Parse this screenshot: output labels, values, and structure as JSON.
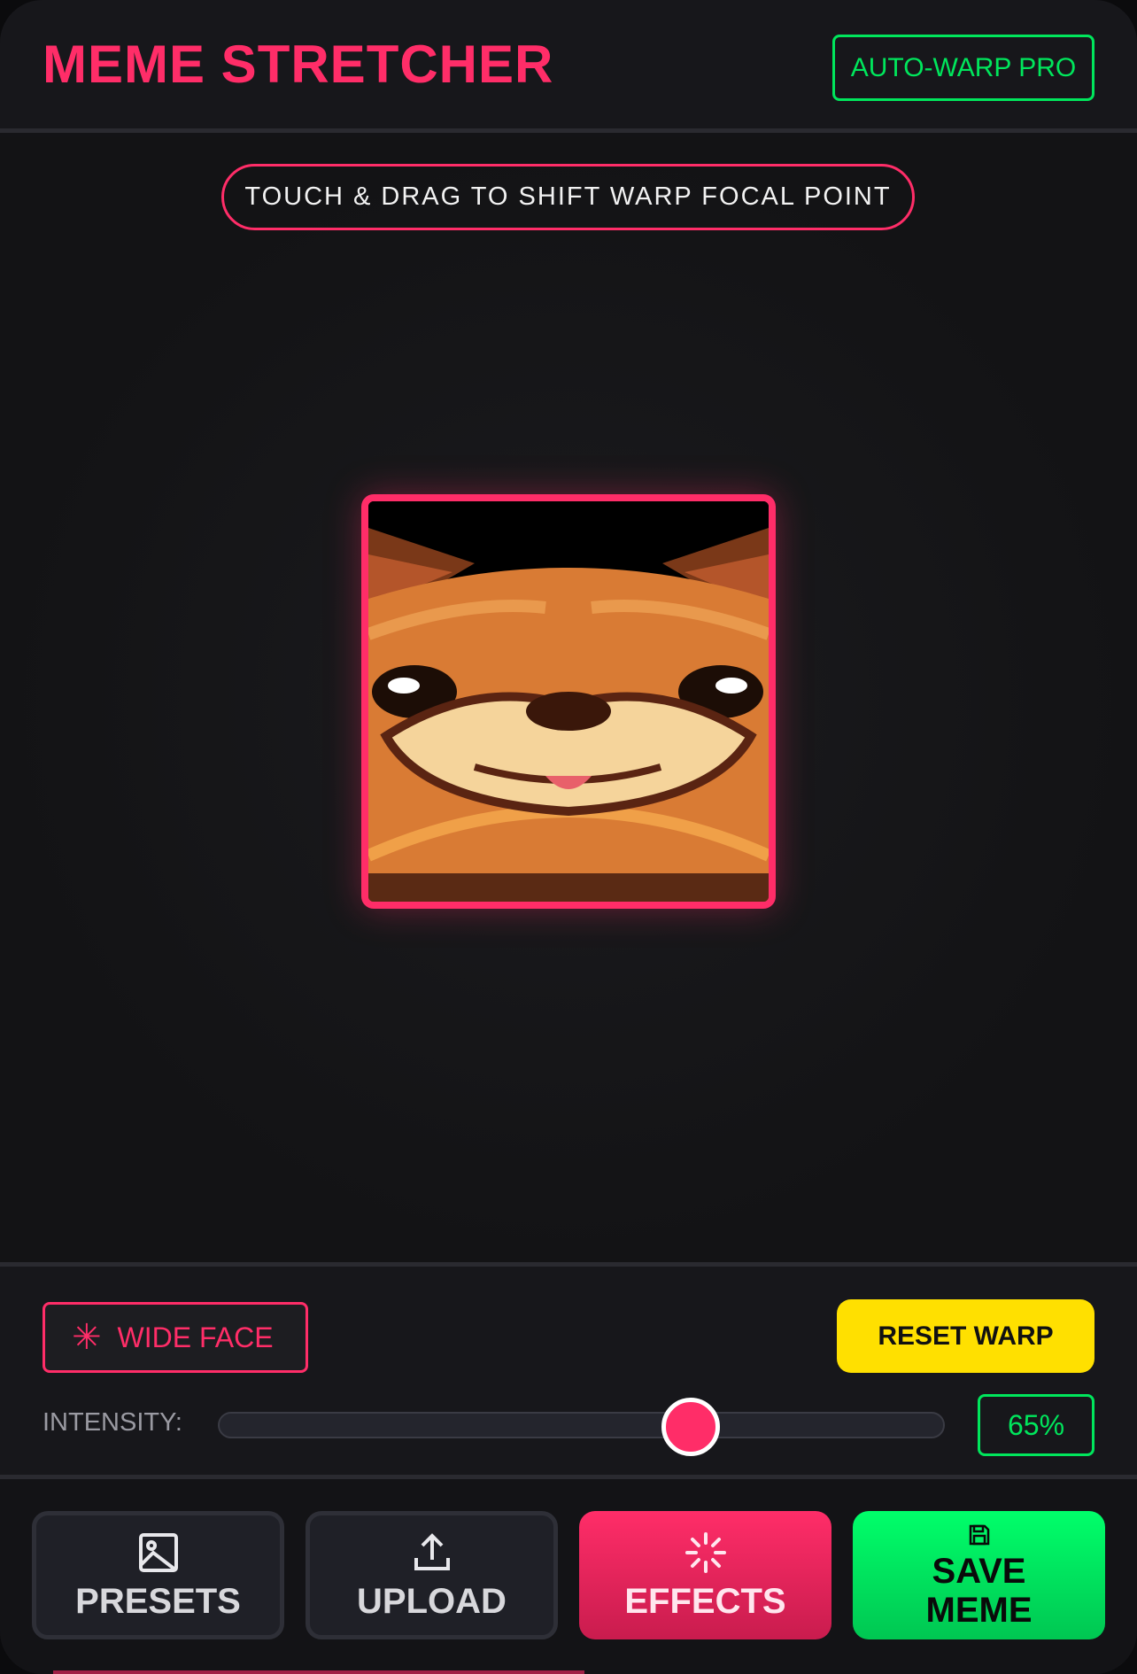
{
  "header": {
    "title": "MEME STRETCHER",
    "badge": "AUTO-WARP PRO"
  },
  "canvas": {
    "hint": "TOUCH & DRAG TO SHIFT WARP FOCAL POINT",
    "image_subject": "stretched shiba dog face"
  },
  "controls": {
    "mode_label": "WIDE FACE",
    "mode_icon": "asterisk-icon",
    "reset_label": "RESET WARP",
    "intensity_label": "INTENSITY:",
    "intensity_fraction": 0.65,
    "intensity_value": "65%"
  },
  "nav": {
    "presets": {
      "label": "PRESETS",
      "icon": "image-icon"
    },
    "upload": {
      "label": "UPLOAD",
      "icon": "upload-icon"
    },
    "effects": {
      "label": "EFFECTS",
      "icon": "sparkle-icon"
    },
    "save": {
      "label": "SAVE MEME",
      "icon": "floppy-icon"
    }
  },
  "colors": {
    "accent": "#ff2d68",
    "pro_green": "#00e65c",
    "reset_yellow": "#ffe000",
    "background": "#131316"
  }
}
